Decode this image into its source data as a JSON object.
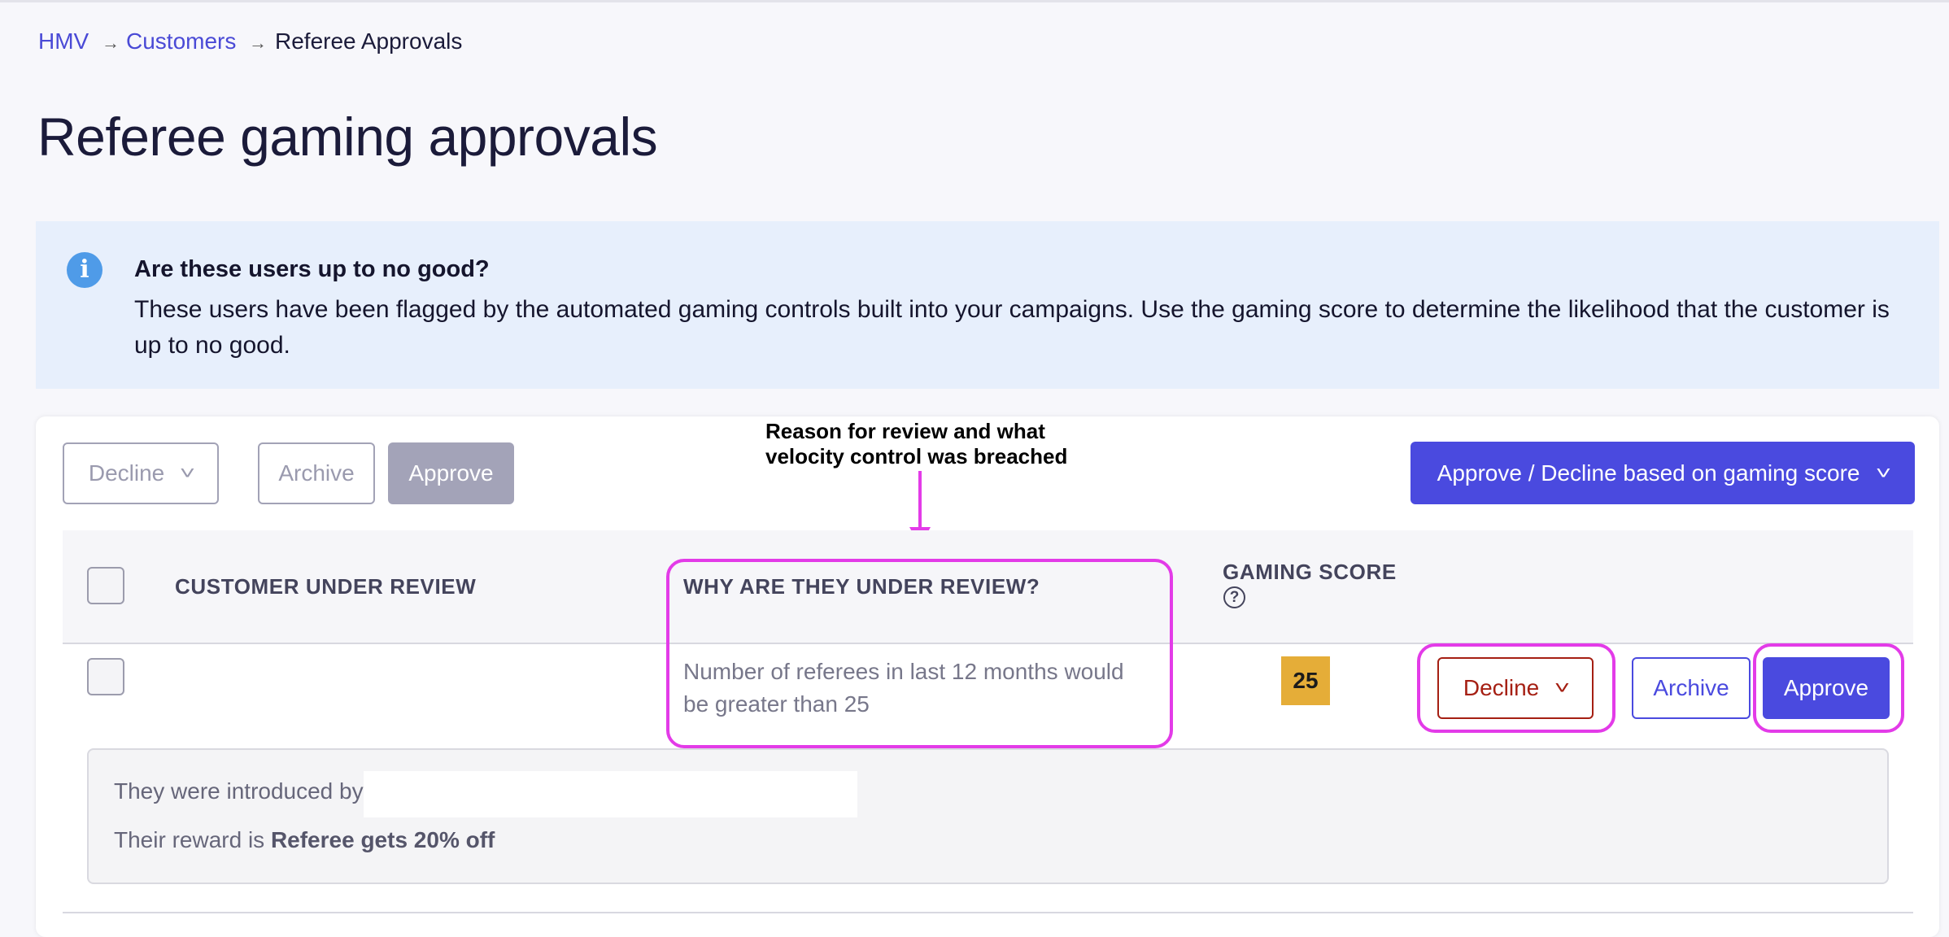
{
  "breadcrumb": {
    "items": [
      "HMV",
      "Customers",
      "Referee Approvals"
    ],
    "separator": "→"
  },
  "page": {
    "title": "Referee gaming approvals"
  },
  "banner": {
    "icon": "info-icon",
    "title": "Are these users up to no good?",
    "body": "These users have been flagged by the automated gaming controls built into your campaigns. Use the gaming score to determine the likelihood that the customer is up to no good."
  },
  "toolbar": {
    "decline_label": "Decline",
    "archive_label": "Archive",
    "approve_label": "Approve",
    "bulk_label": "Approve / Decline based on gaming score"
  },
  "annotation": {
    "text_line1": "Reason for review and what",
    "text_line2": "velocity control was breached"
  },
  "table": {
    "columns": {
      "customer": "CUSTOMER UNDER REVIEW",
      "why": "WHY ARE THEY UNDER REVIEW?",
      "score": "GAMING SCORE"
    },
    "rows": [
      {
        "reason": "Number of referees in last 12 months would be greater than 25",
        "score": "25",
        "decline_label": "Decline",
        "archive_label": "Archive",
        "approve_label": "Approve",
        "details": {
          "introduced_prefix": "They were introduced by",
          "reward_prefix": "Their reward is",
          "reward_value": "Referee gets 20% off"
        }
      }
    ]
  },
  "colors": {
    "primary": "#4a4adf",
    "decline": "#a51f13",
    "highlight": "#e33be8",
    "score_badge": "#e5ad38",
    "banner_bg": "#e7effc"
  }
}
